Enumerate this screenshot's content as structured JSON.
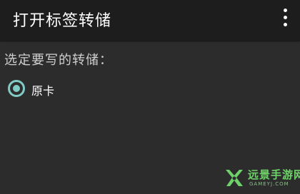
{
  "appbar": {
    "title": "打开标签转储",
    "overflow_icon": "more-vert-icon"
  },
  "content": {
    "prompt": "选定要写的转储：",
    "options": [
      {
        "label": "原卡",
        "selected": true
      }
    ]
  },
  "watermark": {
    "name": "远景手游网",
    "domain": "GAMEYJ.COM"
  },
  "colors": {
    "appbar": "#1d1d1d",
    "background": "#2c2c2c",
    "accent": "#80cbc4",
    "watermark_green": "#6fd26a"
  }
}
